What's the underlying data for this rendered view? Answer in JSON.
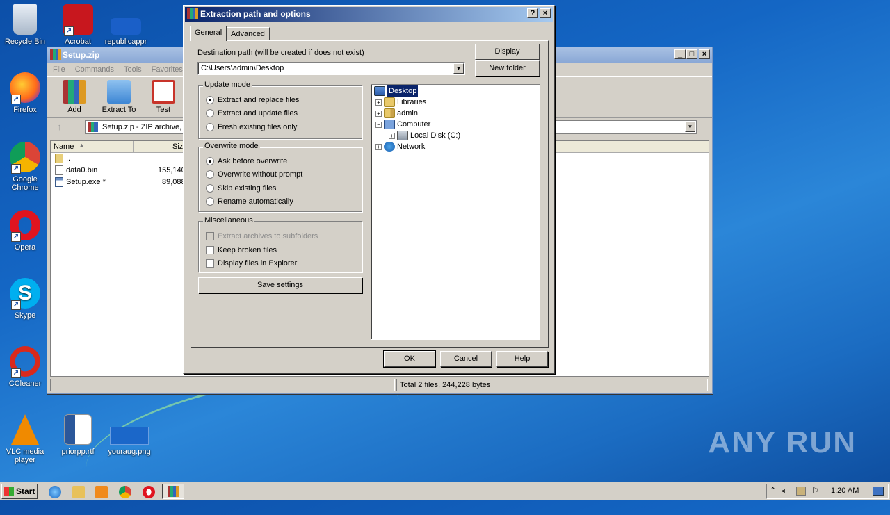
{
  "desktop": {
    "icons": [
      {
        "label": "Recycle Bin",
        "icon": "recycle-bin-icon"
      },
      {
        "label": "Acrobat",
        "icon": "acrobat-icon"
      },
      {
        "label": "republicappr",
        "icon": "file-icon"
      },
      {
        "label": "Firefox",
        "icon": "firefox-icon"
      },
      {
        "label": "Google Chrome",
        "icon": "chrome-icon"
      },
      {
        "label": "Opera",
        "icon": "opera-icon"
      },
      {
        "label": "Skype",
        "icon": "skype-icon"
      },
      {
        "label": "CCleaner",
        "icon": "ccleaner-icon"
      },
      {
        "label": "VLC media player",
        "icon": "vlc-icon"
      },
      {
        "label": "priorpp.rtf",
        "icon": "word-doc-icon"
      },
      {
        "label": "youraug.png",
        "icon": "image-file-icon"
      }
    ],
    "watermark": "ANY RUN"
  },
  "winrar": {
    "title": "Setup.zip",
    "menu": [
      "File",
      "Commands",
      "Tools",
      "Favorites"
    ],
    "toolbar": [
      {
        "label": "Add",
        "icon": "add-archive-icon"
      },
      {
        "label": "Extract To",
        "icon": "extract-folder-icon"
      },
      {
        "label": "Test",
        "icon": "test-clipboard-icon"
      }
    ],
    "address": "Setup.zip - ZIP archive,",
    "columns": {
      "name": "Name",
      "size": "Size"
    },
    "files": [
      {
        "name": "..",
        "size": ""
      },
      {
        "name": "data0.bin",
        "size": "155,140"
      },
      {
        "name": "Setup.exe *",
        "size": "89,088"
      }
    ],
    "status_total": "Total 2 files, 244,228 bytes"
  },
  "dialog": {
    "title": "Extraction path and options",
    "help_btn": "?",
    "close_btn": "×",
    "tabs": [
      "General",
      "Advanced"
    ],
    "dest_label": "Destination path (will be created if does not exist)",
    "dest_value": "C:\\Users\\admin\\Desktop",
    "display_btn": "Display",
    "new_folder_btn": "New folder",
    "update_mode": {
      "legend": "Update mode",
      "options": [
        "Extract and replace files",
        "Extract and update files",
        "Fresh existing files only"
      ],
      "selected": 0
    },
    "overwrite_mode": {
      "legend": "Overwrite mode",
      "options": [
        "Ask before overwrite",
        "Overwrite without prompt",
        "Skip existing files",
        "Rename automatically"
      ],
      "selected": 0
    },
    "misc": {
      "legend": "Miscellaneous",
      "options": [
        "Extract archives to subfolders",
        "Keep broken files",
        "Display files in Explorer"
      ]
    },
    "save_btn": "Save settings",
    "tree": [
      "Desktop",
      "Libraries",
      "admin",
      "Computer",
      "Local Disk (C:)",
      "Network"
    ],
    "ok": "OK",
    "cancel": "Cancel",
    "help": "Help"
  },
  "taskbar": {
    "start": "Start",
    "clock": "1:20 AM"
  },
  "colors": {
    "title_active": "#0a246a",
    "face": "#d4d0c8",
    "desktop": "#1466c4"
  }
}
